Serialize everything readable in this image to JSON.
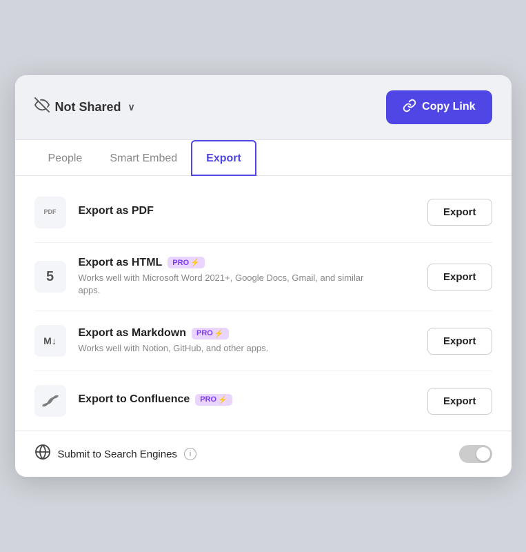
{
  "header": {
    "not_shared_label": "Not Shared",
    "copy_link_label": "Copy Link",
    "chevron": "∨"
  },
  "tabs": [
    {
      "id": "people",
      "label": "People",
      "active": false
    },
    {
      "id": "smart-embed",
      "label": "Smart Embed",
      "active": false
    },
    {
      "id": "export",
      "label": "Export",
      "active": true
    }
  ],
  "export_items": [
    {
      "id": "pdf",
      "icon_label": "PDF",
      "icon_type": "pdf",
      "title": "Export as PDF",
      "pro": false,
      "description": "",
      "button_label": "Export"
    },
    {
      "id": "html",
      "icon_label": "5",
      "icon_type": "html",
      "title": "Export as HTML",
      "pro": true,
      "description": "Works well with Microsoft Word 2021+, Google Docs, Gmail, and similar apps.",
      "button_label": "Export"
    },
    {
      "id": "markdown",
      "icon_label": "M↓",
      "icon_type": "md",
      "title": "Export as Markdown",
      "pro": true,
      "description": "Works well with Notion, GitHub, and other apps.",
      "button_label": "Export"
    },
    {
      "id": "confluence",
      "icon_label": "",
      "icon_type": "confluence",
      "title": "Export to Confluence",
      "pro": true,
      "description": "",
      "button_label": "Export"
    }
  ],
  "footer": {
    "label": "Submit to Search Engines",
    "info_title": "i",
    "toggle_on": false
  },
  "pro_badge": {
    "label": "PRO",
    "icon": "⚡"
  }
}
